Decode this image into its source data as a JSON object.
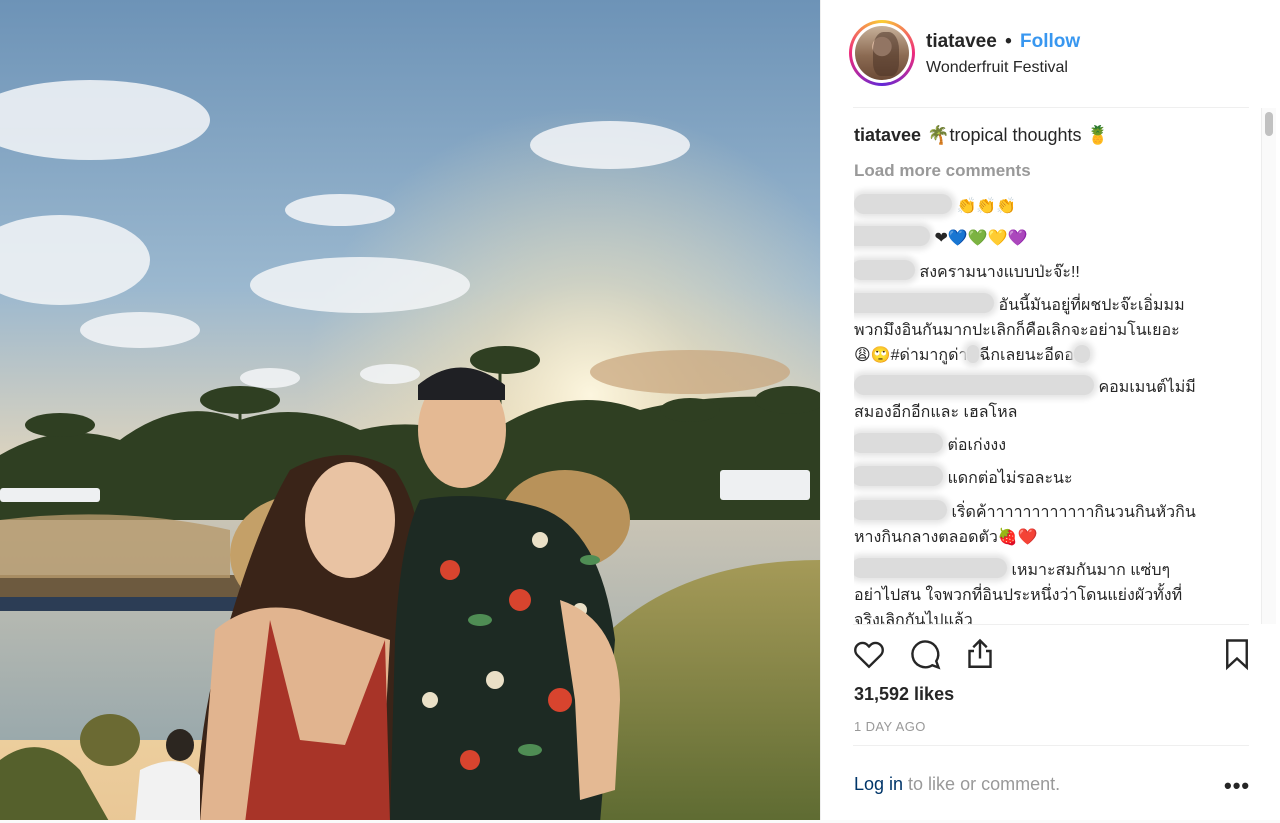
{
  "post": {
    "username": "tiatavee",
    "follow_label": "Follow",
    "separator": "•",
    "location": "Wonderfruit Festival",
    "photo_icon": "photo-couple-sunset"
  },
  "caption": {
    "username": "tiatavee",
    "text": "🌴tropical thoughts 🍍"
  },
  "comments": {
    "load_more": "Load more comments",
    "items": [
      {
        "text": "👏👏👏"
      },
      {
        "text": "❤💙💚💛💜"
      },
      {
        "text": "สงครามนางแบบป่ะจ๊ะ!!"
      },
      {
        "text": "อันนี้มันอยู่ที่ผชปะจ๊ะเอิ่มมม",
        "line2": "พวกมึงอินกันมากปะเลิกก็คือเลิกจะอย่ามโนเยอะ",
        "line3a": "😩🙄#ด่ามากูด่า",
        "line3b": "ฉีกเลยนะอีดอ"
      },
      {
        "text": "คอมเมนต์ไม่มี",
        "line2": "สมองอีกอีกและ เฮลโหล"
      },
      {
        "text": "ต่อเก่งงง"
      },
      {
        "text": "แดกต่อไม่รอละนะ"
      },
      {
        "text": "เริ่ดค้าาาาาาาาาาาากินวนกินหัวกิน",
        "line2": "หางกินกลางตลอดตัว🍓❤️"
      },
      {
        "text": "เหมาะสมกันมาก แซ่บๆ",
        "line2": "อย่าไปสน ใจพวกที่อินประหนึ่งว่าโดนแย่งผัวทั้งที่",
        "line3": "จริงเลิกกันไปแล้ว"
      }
    ]
  },
  "actions": {
    "like_icon": "heart-icon",
    "comment_icon": "comment-icon",
    "share_icon": "share-icon",
    "save_icon": "bookmark-icon"
  },
  "likes": "31,592 likes",
  "time_ago": "1 DAY AGO",
  "footer": {
    "login_link": "Log in",
    "login_rest": " to like or comment.",
    "more": "•••"
  },
  "colors": {
    "link_blue": "#3897f0",
    "muted_gray": "#999999",
    "text_dark": "#262626",
    "login_blue": "#003569"
  }
}
